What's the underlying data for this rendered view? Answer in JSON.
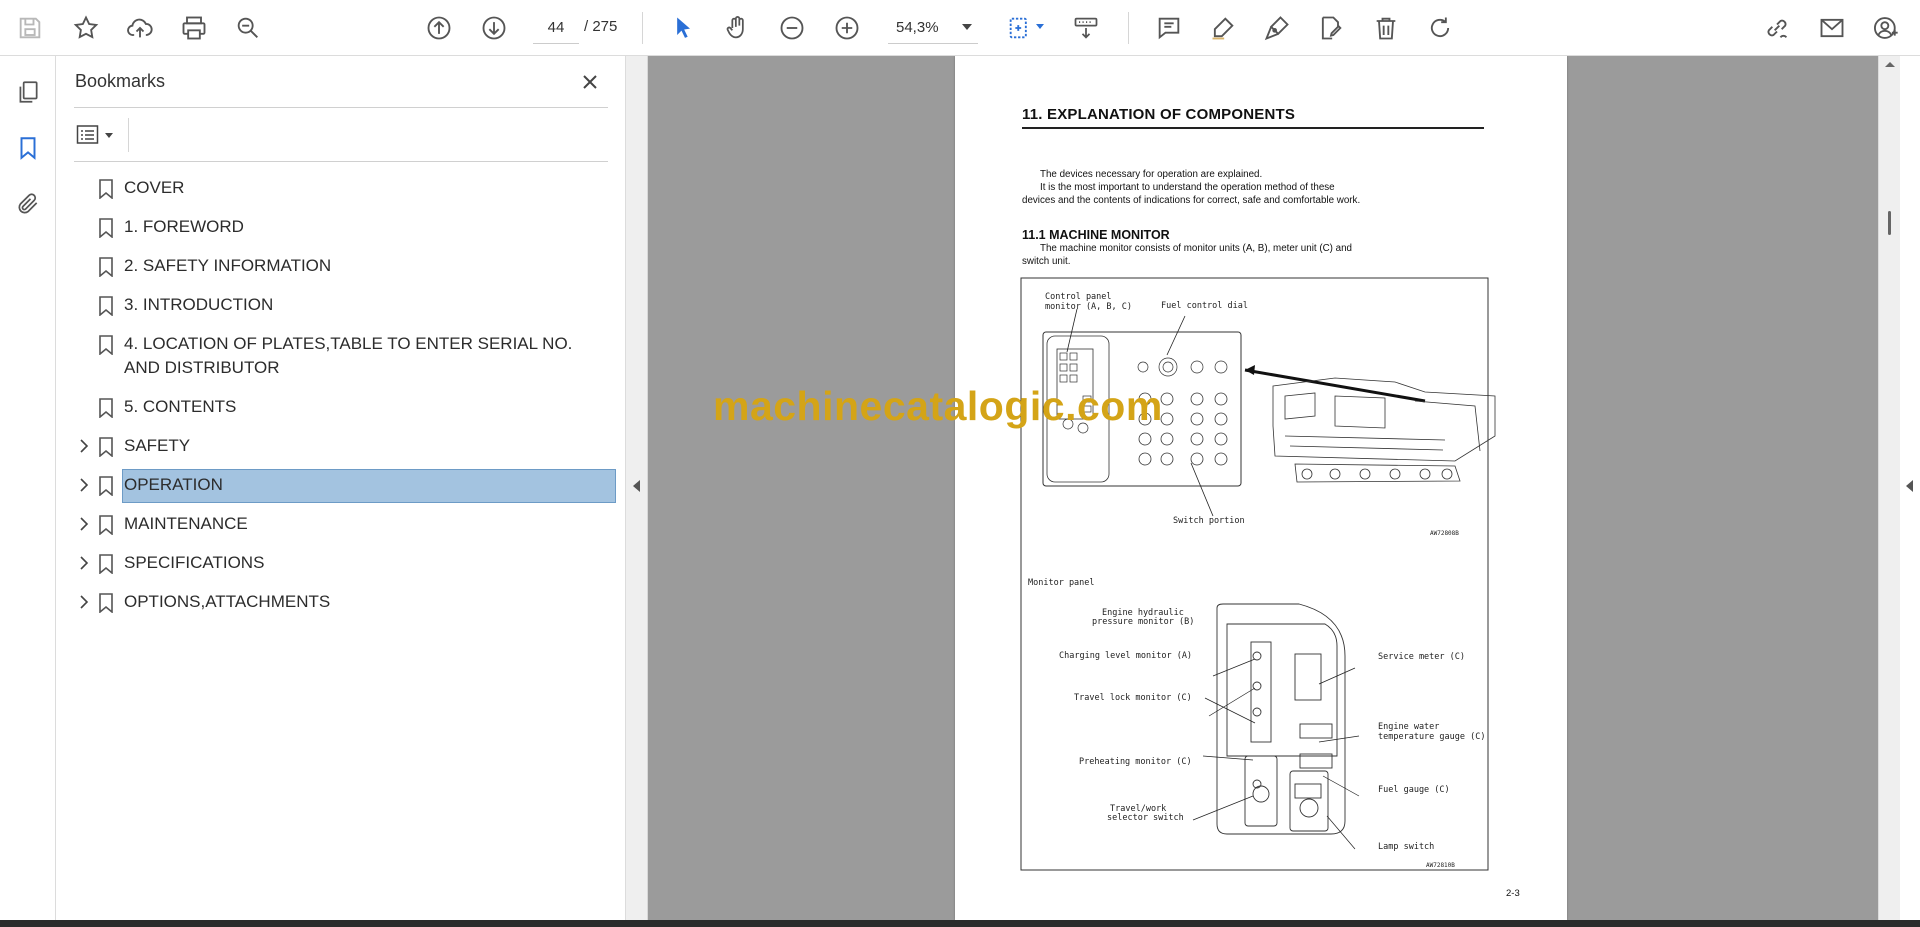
{
  "toolbar": {
    "page_current": "44",
    "page_total": "/ 275",
    "zoom_value": "54,3%"
  },
  "bookmarks_panel": {
    "title": "Bookmarks",
    "items": [
      {
        "label": "COVER",
        "expandable": false
      },
      {
        "label": "1. FOREWORD",
        "expandable": false
      },
      {
        "label": "2. SAFETY INFORMATION",
        "expandable": false
      },
      {
        "label": "3. INTRODUCTION",
        "expandable": false
      },
      {
        "label": "4. LOCATION OF PLATES,TABLE TO ENTER SERIAL NO. AND DISTRIBUTOR",
        "expandable": false
      },
      {
        "label": "5. CONTENTS",
        "expandable": false
      },
      {
        "label": "SAFETY",
        "expandable": true
      },
      {
        "label": "OPERATION",
        "expandable": true,
        "selected": true
      },
      {
        "label": "MAINTENANCE",
        "expandable": true
      },
      {
        "label": "SPECIFICATIONS",
        "expandable": true
      },
      {
        "label": "OPTIONS,ATTACHMENTS",
        "expandable": true
      }
    ]
  },
  "document": {
    "heading": "11.  EXPLANATION OF COMPONENTS",
    "intro_1": "The devices necessary for operation are explained.",
    "intro_2": "It is the most important to understand the operation method of these devices and the contents of indications for correct, safe and comfortable work.",
    "sub_heading": "11.1  MACHINE MONITOR",
    "sub_text": "The machine monitor consists of monitor units (A, B), meter unit (C) and switch unit.",
    "fig1_label_control": "Control panel",
    "fig1_label_control2": "monitor (A, B, C)",
    "fig1_label_fuel": "Fuel control dial",
    "fig1_label_switch": "Switch portion",
    "fig1_code": "AW72808B",
    "fig2_title": "Monitor panel",
    "fig2_engine_hyd": "Engine hydraulic",
    "fig2_engine_hyd2": "pressure monitor (B)",
    "fig2_charging": "Charging level monitor (A)",
    "fig2_travel_lock": "Travel lock monitor (C)",
    "fig2_preheating": "Preheating monitor (C)",
    "fig2_travel_work": "Travel/work",
    "fig2_travel_work2": "selector switch",
    "fig2_service": "Service meter (C)",
    "fig2_water": "Engine water",
    "fig2_water2": "temperature gauge (C)",
    "fig2_fuel": "Fuel gauge (C)",
    "fig2_lamp": "Lamp switch",
    "fig2_code": "AW72810B",
    "page_number": "2-3",
    "watermark": "machinecatalogic.com"
  },
  "colors": {
    "selection": "#a3c3e0",
    "watermark": "#d4a417",
    "doc_background": "#9b9b9b",
    "tool_blue": "#2a6fd6"
  }
}
